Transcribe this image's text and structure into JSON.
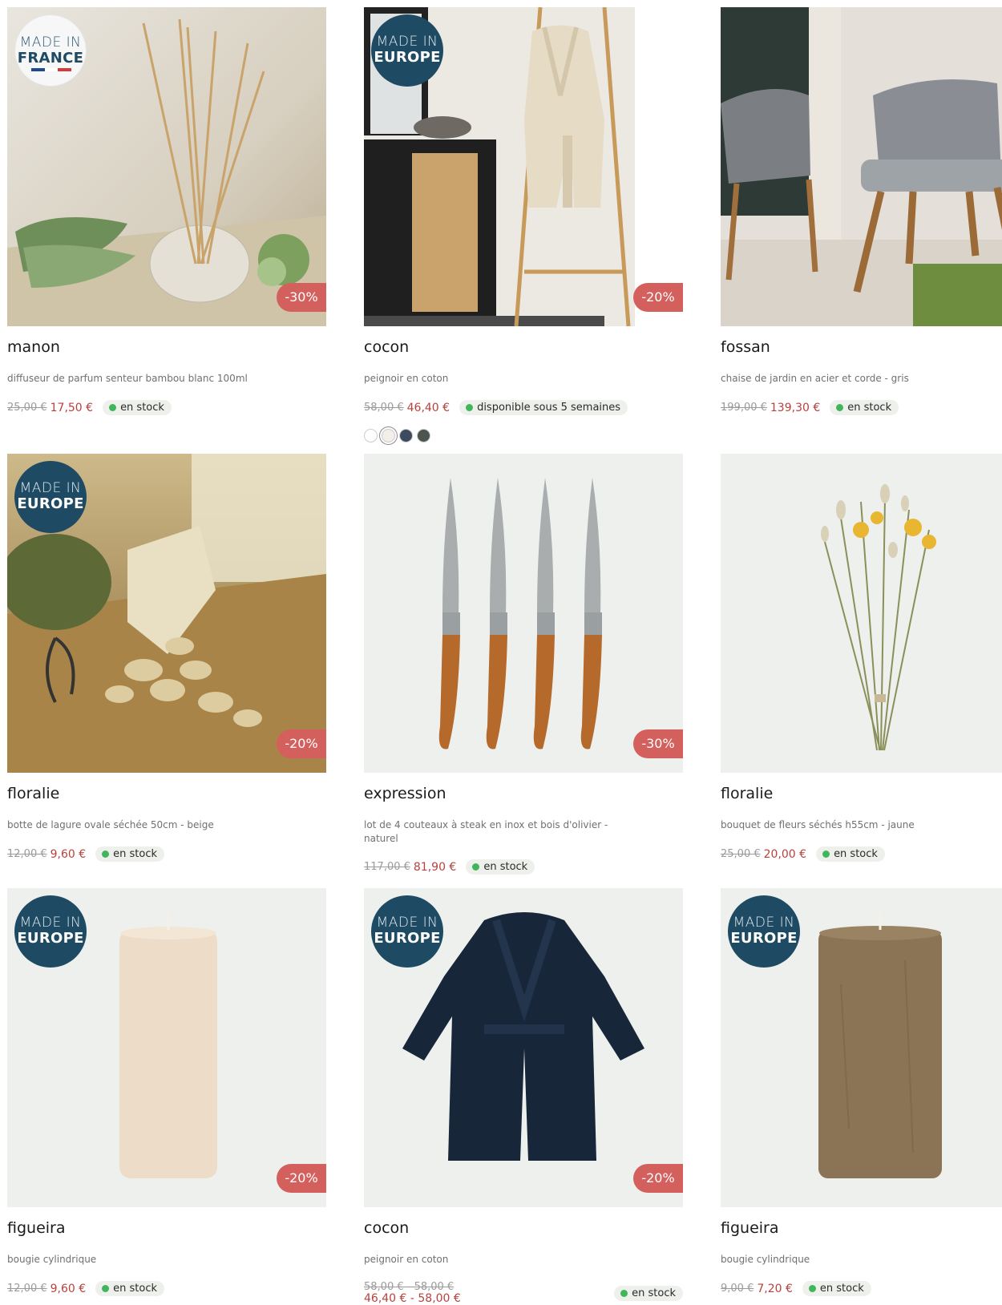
{
  "products": [
    {
      "name": "manon",
      "desc": "diffuseur de parfum senteur bambou blanc 100ml",
      "old_price": "25,00 €",
      "new_price": "17,50 €",
      "stock": "en stock",
      "discount": "-30%",
      "badge": {
        "line1": "MADE IN",
        "line2": "FRANCE"
      }
    },
    {
      "name": "cocon",
      "desc": "peignoir en coton",
      "old_price": "58,00 €",
      "new_price": "46,40 €",
      "stock": "disponible sous 5 semaines",
      "discount": "-20%",
      "badge": {
        "line1": "MADE IN",
        "line2": "EUROPE"
      },
      "swatches": [
        "#ffffff",
        "#f1efe8",
        "#3e4a5e",
        "#4c5450"
      ]
    },
    {
      "name": "fossan",
      "desc": "chaise de jardin en acier et corde - gris",
      "old_price": "199,00 €",
      "new_price": "139,30 €",
      "stock": "en stock"
    },
    {
      "name": "floralie",
      "desc": "botte de lagure ovale séchée 50cm - beige",
      "old_price": "12,00 €",
      "new_price": "9,60 €",
      "stock": "en stock",
      "discount": "-20%",
      "badge": {
        "line1": "MADE IN",
        "line2": "EUROPE"
      }
    },
    {
      "name": "expression",
      "desc": "lot de 4 couteaux à steak en inox et bois d'olivier - naturel",
      "old_price": "117,00 €",
      "new_price": "81,90 €",
      "stock": "en stock",
      "discount": "-30%"
    },
    {
      "name": "floralie",
      "desc": "bouquet de fleurs séchés h55cm - jaune",
      "old_price": "25,00 €",
      "new_price": "20,00 €",
      "stock": "en stock"
    },
    {
      "name": "figueira",
      "desc": "bougie cylindrique",
      "old_price": "12,00 €",
      "new_price": "9,60 €",
      "stock": "en stock",
      "discount": "-20%",
      "badge": {
        "line1": "MADE IN",
        "line2": "EUROPE"
      }
    },
    {
      "name": "cocon",
      "desc": "peignoir en coton",
      "old_price": "58,00 € - 58,00 €",
      "new_price": "46,40 € - 58,00 €",
      "stock": "en stock",
      "discount": "-20%",
      "badge": {
        "line1": "MADE IN",
        "line2": "EUROPE"
      }
    },
    {
      "name": "figueira",
      "desc": "bougie cylindrique",
      "old_price": "9,00 €",
      "new_price": "7,20 €",
      "stock": "en stock",
      "badge": {
        "line1": "MADE IN",
        "line2": "EUROPE"
      }
    }
  ],
  "colors": {
    "accent_discount": "#d4605d",
    "price_new": "#b9413d",
    "stock_dot": "#3fb55c",
    "badge_bg": "#1e4a63"
  }
}
